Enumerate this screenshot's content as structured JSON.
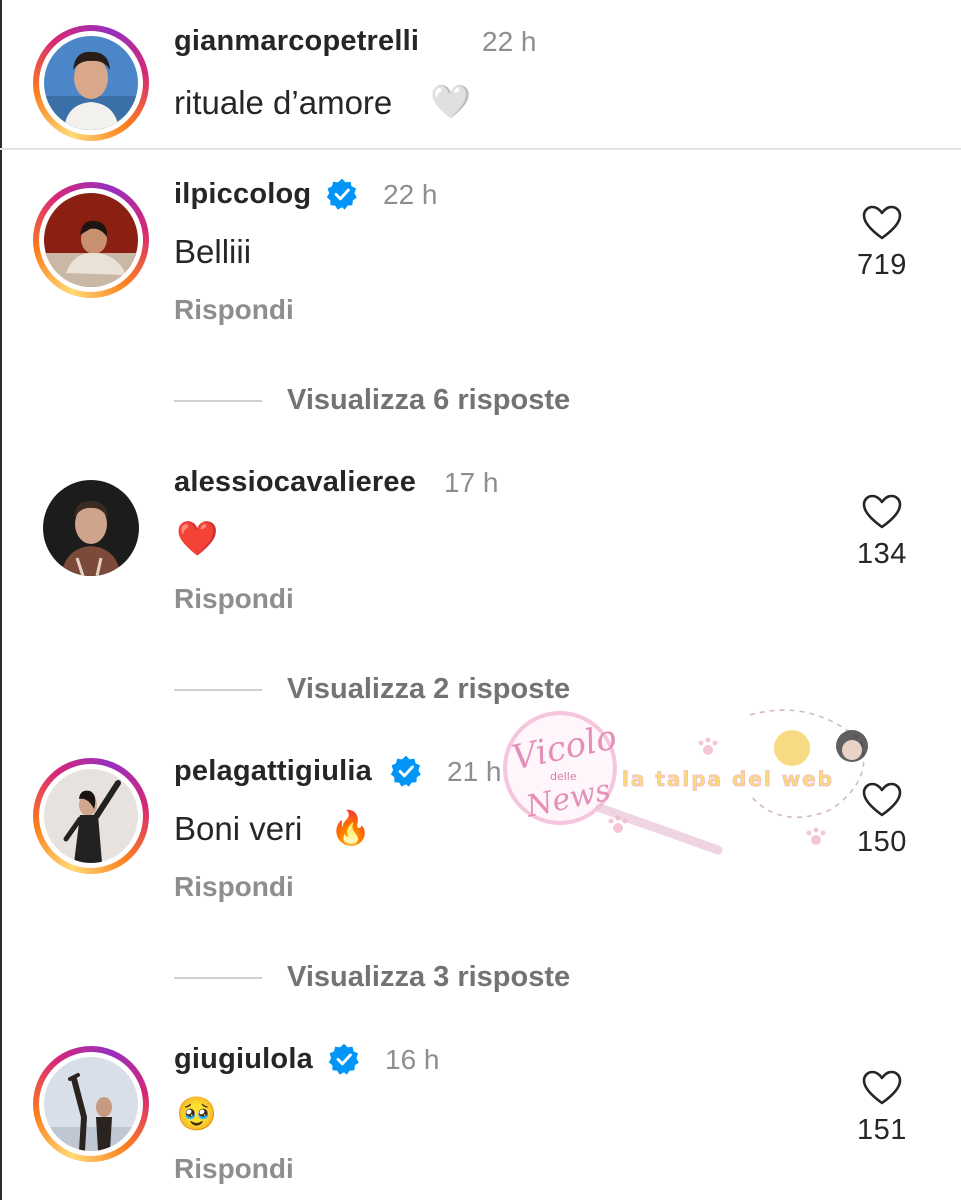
{
  "post": {
    "username": "gianmarcopetrelli",
    "time": "22 h",
    "caption_text": "rituale d’amore",
    "caption_emoji": "🤍"
  },
  "comments": [
    {
      "username": "ilpiccolog",
      "verified": true,
      "time": "22 h",
      "text": "Belliii",
      "likes": "719",
      "reply_label": "Rispondi",
      "view_replies": "Visualizza 6 risposte"
    },
    {
      "username": "alessiocavalieree",
      "verified": false,
      "time": "17 h",
      "text": "❤️",
      "likes": "134",
      "reply_label": "Rispondi",
      "view_replies": "Visualizza 2 risposte"
    },
    {
      "username": "pelagattigiulia",
      "verified": true,
      "time": "21 h",
      "text": "Boni veri",
      "text_emoji": "🔥",
      "likes": "150",
      "reply_label": "Rispondi",
      "view_replies": "Visualizza 3 risposte"
    },
    {
      "username": "giugiulola",
      "verified": true,
      "time": "16 h",
      "text": "🥹",
      "likes": "151",
      "reply_label": "Rispondi"
    }
  ],
  "watermark": {
    "logo_text_1": "Vicolo",
    "logo_text_2": "delle",
    "logo_text_3": "News",
    "banner_text": "la talpa del web"
  },
  "colors": {
    "verified_blue": "#0095f6",
    "muted_text": "#8e8e8e",
    "primary_text": "#262626",
    "ring_gradient": [
      "#feda75",
      "#fa7e1e",
      "#d62976",
      "#962fbf"
    ]
  }
}
